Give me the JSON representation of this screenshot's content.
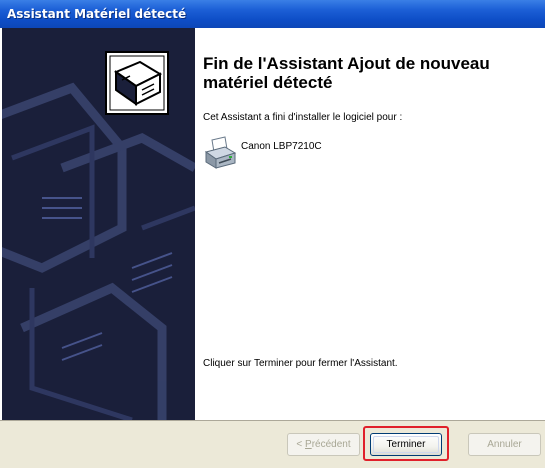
{
  "window": {
    "title": "Assistant Matériel détecté"
  },
  "content": {
    "heading": "Fin de l'Assistant Ajout de nouveau matériel détecté",
    "intro": "Cet Assistant a fini d'installer le logiciel pour :",
    "device_name": "Canon LBP7210C",
    "closing": "Cliquer sur Terminer pour fermer l'Assistant."
  },
  "footer": {
    "prev_label_accel": "P",
    "prev_label_rest": "récédent",
    "prev_prefix": "< ",
    "finish_label": "Terminer",
    "cancel_label": "Annuler"
  },
  "icons": {
    "side": "hardware-wizard-icon",
    "device": "printer-icon"
  },
  "colors": {
    "titlebar": "#0e4ec7",
    "side_panel": "#1a1f3a",
    "footer": "#ece9d8",
    "highlight": "#e0202a"
  }
}
